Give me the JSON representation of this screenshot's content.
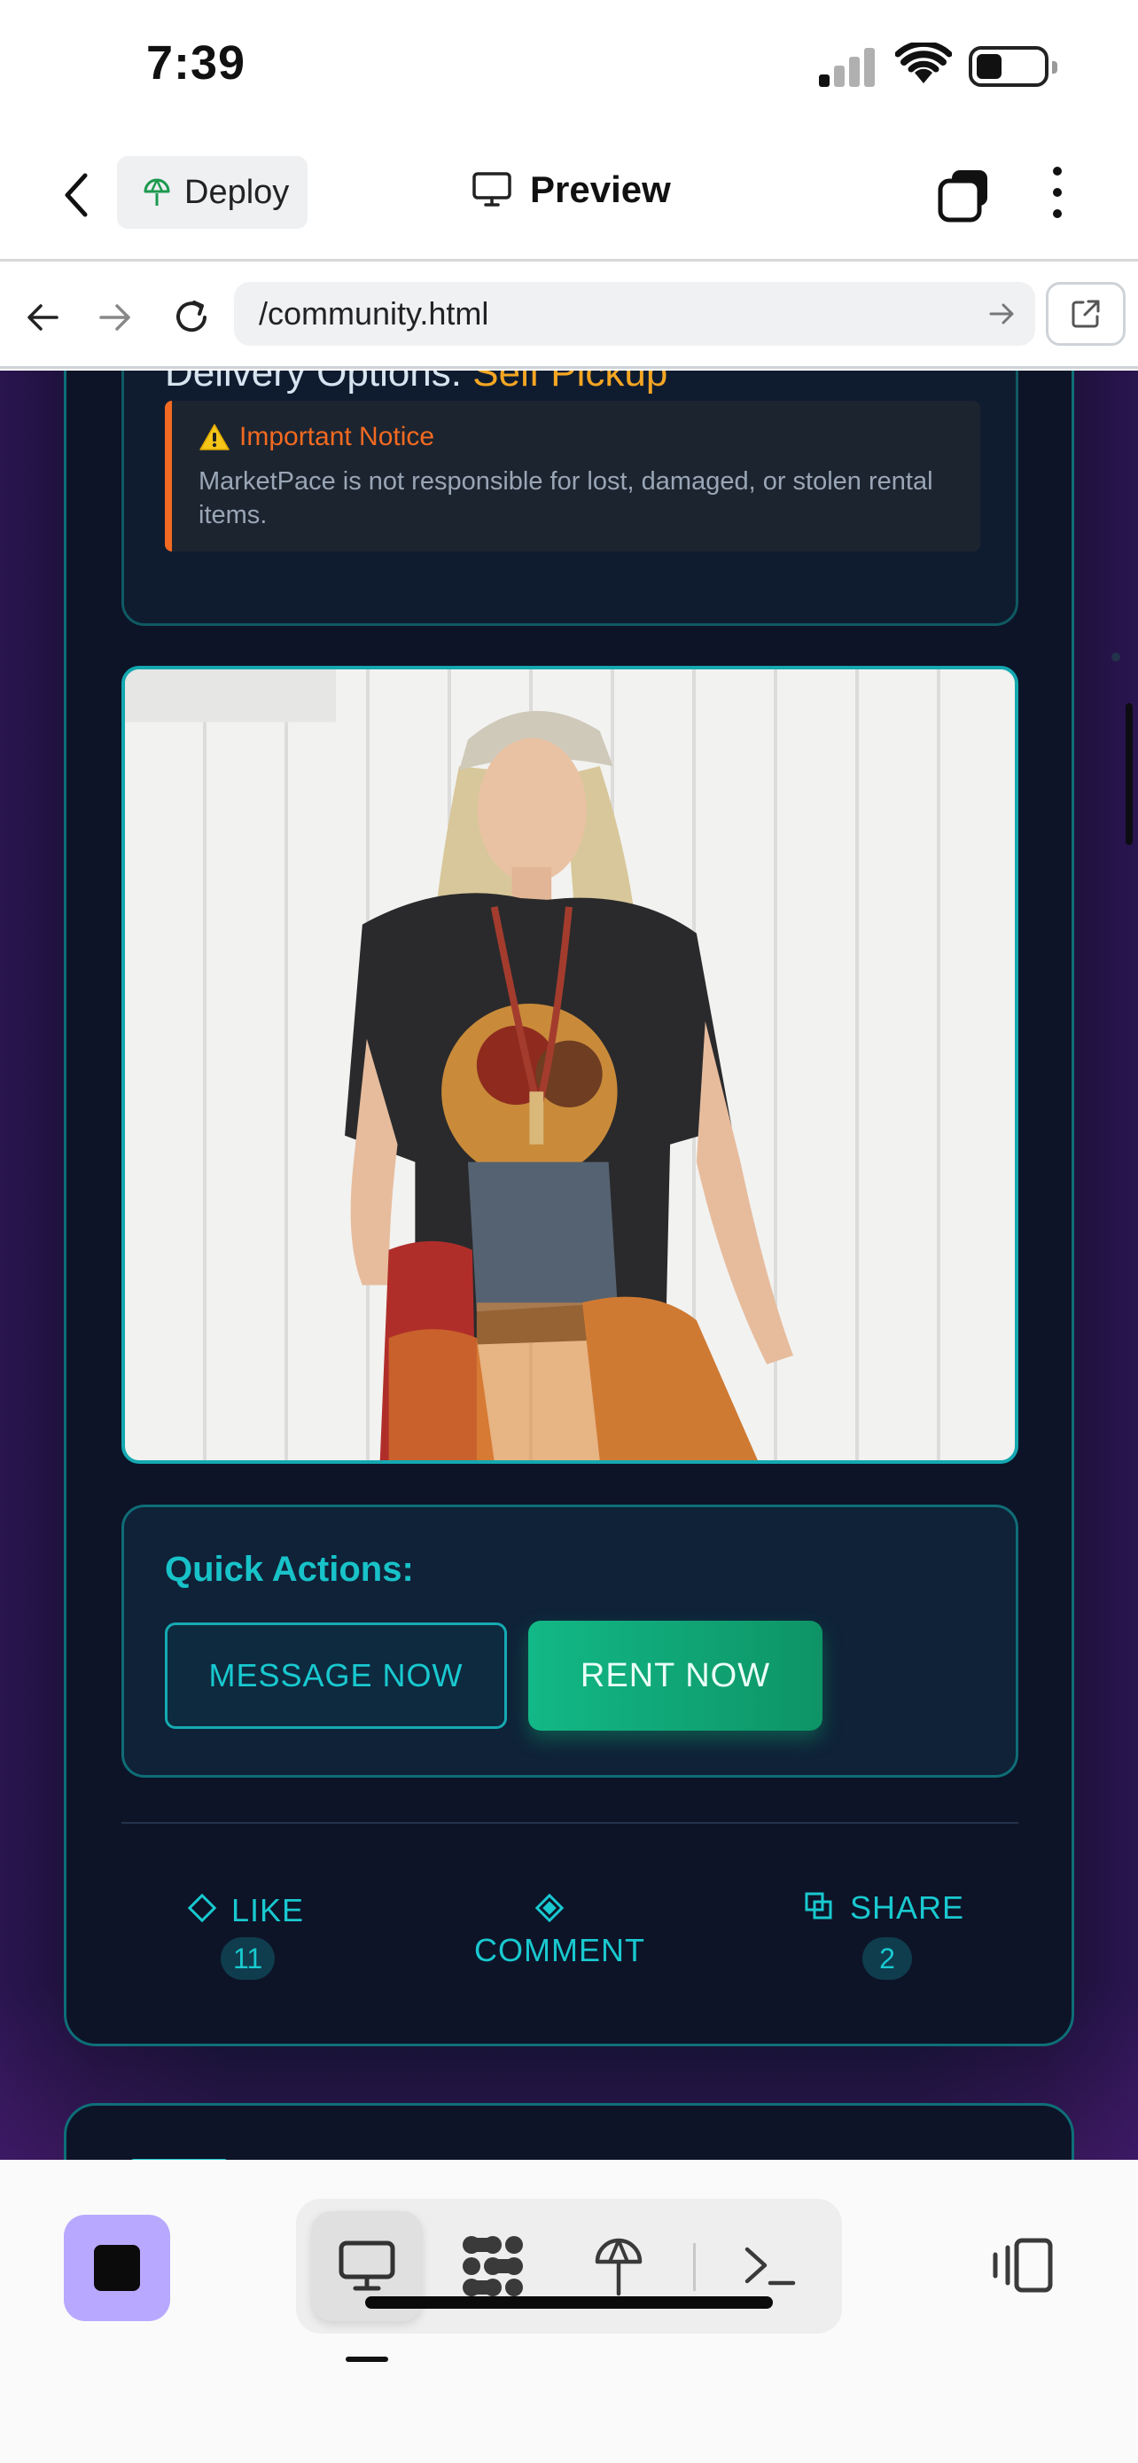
{
  "status_bar": {
    "time": "7:39"
  },
  "app_bar": {
    "deploy_label": "Deploy",
    "preview_label": "Preview"
  },
  "browser": {
    "url": "/community.html"
  },
  "post": {
    "delivery_label": "Delivery Options:",
    "delivery_value": "Self Pickup",
    "notice_title": "Important Notice",
    "notice_body": "MarketPace is not responsible for lost, damaged, or stolen rental items.",
    "quick_actions_title": "Quick Actions:",
    "message_label": "MESSAGE NOW",
    "rent_label": "RENT NOW",
    "like_label": "LIKE",
    "like_count": "11",
    "comment_label": "COMMENT",
    "share_label": "SHARE",
    "share_count": "2"
  },
  "colors": {
    "accent_teal": "#18c2c9",
    "rent_green": "#12b886",
    "notice_orange": "#f26a21",
    "delivery_gold": "#f5a623",
    "stop_purple": "#b9a8ff"
  },
  "icons": {
    "app_bar": [
      "chevron-left-icon",
      "deploy-icon",
      "monitor-icon",
      "tabs-icon",
      "more-vertical-icon"
    ],
    "browser": [
      "arrow-left-icon",
      "arrow-right-icon",
      "reload-icon",
      "go-arrow-icon",
      "external-link-icon"
    ],
    "post": [
      "warning-icon",
      "like-diamond-icon",
      "comment-diamond-icon",
      "share-copy-icon"
    ],
    "toolbar": [
      "stop-icon",
      "monitor-icon",
      "extensions-icon",
      "deploy-icon",
      "terminal-icon",
      "device-layout-icon"
    ]
  }
}
